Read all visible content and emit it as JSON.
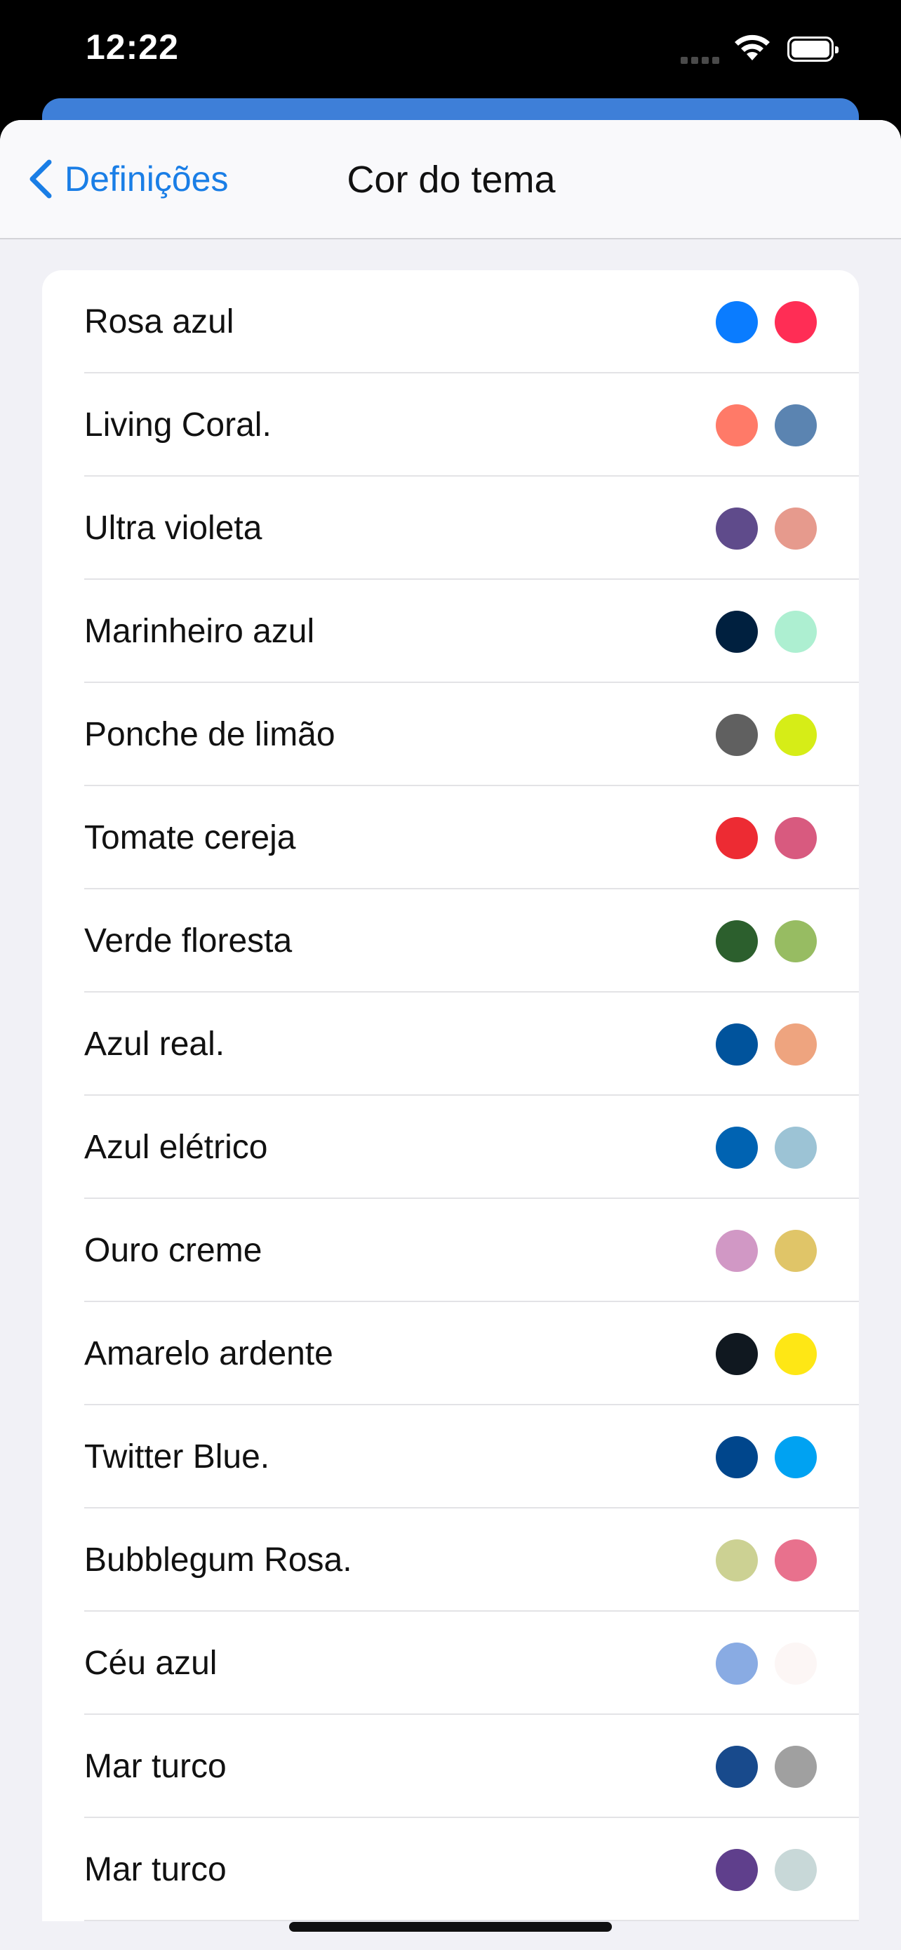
{
  "status_bar": {
    "time": "12:22"
  },
  "nav": {
    "back_label": "Definições",
    "title": "Cor do tema"
  },
  "themes": [
    {
      "name": "Rosa azul",
      "colors": [
        "#0a7cff",
        "#ff2d55"
      ]
    },
    {
      "name": "Living Coral.",
      "colors": [
        "#ff7a68",
        "#5b84b1"
      ]
    },
    {
      "name": "Ultra violeta",
      "colors": [
        "#5f4b8b",
        "#e69a8d"
      ]
    },
    {
      "name": "Marinheiro azul",
      "colors": [
        "#00203f",
        "#adefd1"
      ]
    },
    {
      "name": "Ponche de limão",
      "colors": [
        "#606060",
        "#d6ed17"
      ]
    },
    {
      "name": "Tomate cereja",
      "colors": [
        "#ed2b33",
        "#d85a7f"
      ]
    },
    {
      "name": "Verde floresta",
      "colors": [
        "#2c5f2d",
        "#97bc62"
      ]
    },
    {
      "name": "Azul real.",
      "colors": [
        "#00539c",
        "#eea47f"
      ]
    },
    {
      "name": "Azul elétrico",
      "colors": [
        "#0063b2",
        "#9cc3d5"
      ]
    },
    {
      "name": "Ouro creme",
      "colors": [
        "#d198c5",
        "#e0c568"
      ]
    },
    {
      "name": "Amarelo ardente",
      "colors": [
        "#101820",
        "#fee715"
      ]
    },
    {
      "name": "Twitter Blue.",
      "colors": [
        "#00468c",
        "#00a2f2"
      ]
    },
    {
      "name": "Bubblegum Rosa.",
      "colors": [
        "#ccd193",
        "#e8718d"
      ]
    },
    {
      "name": "Céu azul",
      "colors": [
        "#89abe3",
        "#fcf6f5"
      ]
    },
    {
      "name": "Mar turco",
      "colors": [
        "#184a8c",
        "#a0a0a0"
      ]
    },
    {
      "name": "Mar turco",
      "colors": [
        "#5f3f8c",
        "#c8d8d8"
      ]
    }
  ]
}
